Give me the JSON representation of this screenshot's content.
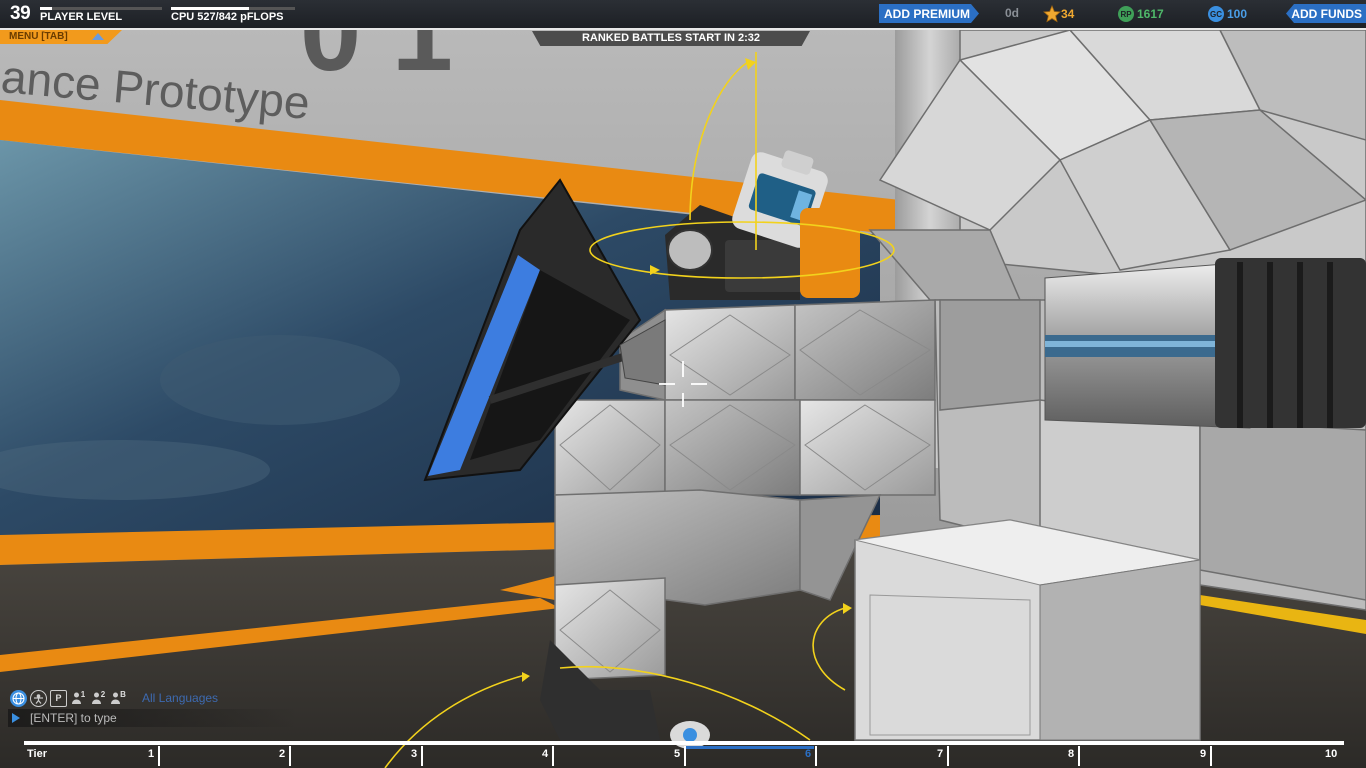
{
  "scene": {
    "wall_text": "ance Prototype",
    "wall_big_text": "0 1"
  },
  "hud": {
    "player_level": "39",
    "player_level_label": "PLAYER LEVEL",
    "level_progress": 0.1,
    "cpu_label": "CPU 527/842 pFLOPS",
    "cpu_used": 527,
    "cpu_max": 842,
    "add_premium_label": "ADD PREMIUM",
    "premium_days": "0d",
    "stars": "34",
    "robits": "1617",
    "robits_icon_text": "RP",
    "galaxy_credits": "100",
    "gc_icon_text": "GC",
    "add_funds_label": "ADD FUNDS",
    "menu_label": "MENU [TAB]",
    "battle_timer": "RANKED BATTLES START IN 2:32"
  },
  "chat": {
    "icons": [
      {
        "name": "globe-icon",
        "text": ""
      },
      {
        "name": "person-icon",
        "text": ""
      },
      {
        "name": "party-icon",
        "text": "P"
      },
      {
        "name": "player-one-icon",
        "text": "1"
      },
      {
        "name": "player-two-icon",
        "text": "2"
      },
      {
        "name": "player-block-icon",
        "text": "B"
      }
    ],
    "language": "All Languages",
    "input_placeholder": "[ENTER] to type"
  },
  "tiers": {
    "label": "Tier",
    "numbers": [
      "1",
      "2",
      "3",
      "4",
      "5",
      "6",
      "7",
      "8",
      "9",
      "10"
    ],
    "active": "6"
  },
  "colors": {
    "accent_blue": "#2b6fc4",
    "menu_orange": "#f29a1c",
    "gizmo_yellow": "#f2d21c",
    "stars_orange": "#f0a830",
    "robits_green": "#4fb86a",
    "gc_blue": "#4a9ee8"
  }
}
